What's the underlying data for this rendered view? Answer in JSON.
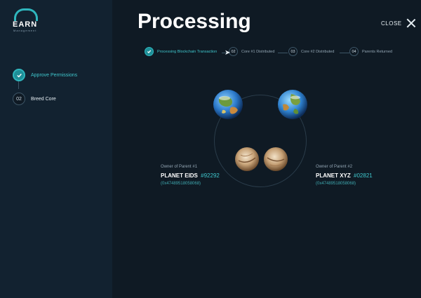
{
  "brand": {
    "name": "EARN",
    "tagline": "Management"
  },
  "page": {
    "title": "Processing",
    "close_label": "CLOSE"
  },
  "sidebar": {
    "steps": [
      {
        "number": "",
        "label": "Approve Permissions",
        "state": "done"
      },
      {
        "number": "02",
        "label": "Breed Core",
        "state": "pending"
      }
    ]
  },
  "progress": {
    "steps": [
      {
        "number": "",
        "label": "Processing Blockchain Transaction",
        "state": "done"
      },
      {
        "number": "02",
        "label": "Core #1 Distributed",
        "state": "pending"
      },
      {
        "number": "03",
        "label": "Core #2 Distributed",
        "state": "pending"
      },
      {
        "number": "04",
        "label": "Parents Returned",
        "state": "pending"
      }
    ]
  },
  "parents": [
    {
      "caption": "Owner of Parent #1",
      "name": "PLANET EIDS",
      "id": "#92292",
      "address": "(0x47489518058068)"
    },
    {
      "caption": "Owner of Parent #2",
      "name": "PLANET XYZ",
      "id": "#02821",
      "address": "(0x47489518058068)"
    }
  ],
  "colors": {
    "accent": "#3fc6cc",
    "background": "#0f1a24",
    "sidebar": "#122230"
  }
}
